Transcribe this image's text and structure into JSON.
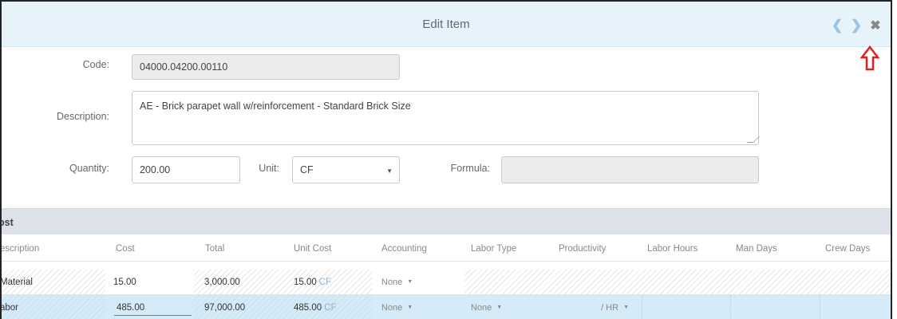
{
  "dialog": {
    "title": "Edit Item"
  },
  "header_icons": {
    "prev": "chevron-left-icon",
    "next": "chevron-right-icon",
    "close": "close-icon"
  },
  "form": {
    "code_label": "Code:",
    "code_value": "04000.04200.00110",
    "description_label": "Description:",
    "description_value": "AE - Brick parapet wall w/reinforcement - Standard Brick Size",
    "quantity_label": "Quantity:",
    "quantity_value": "200.00",
    "unit_label": "Unit:",
    "unit_value": "CF",
    "formula_label": "Formula:",
    "formula_value": ""
  },
  "cost_section": {
    "title": "ost",
    "columns": [
      "escription",
      "Cost",
      "Total",
      "Unit Cost",
      "Accounting",
      "Labor Type",
      "Productivity",
      "Labor Hours",
      "Man Days",
      "Crew Days"
    ],
    "rows": [
      {
        "description": "Material",
        "cost": "15.00",
        "total": "3,000.00",
        "unit_cost": "15.00",
        "unit": "CF",
        "accounting": "None",
        "labor_type": "",
        "productivity": "",
        "labor_hours": "",
        "man_days": "",
        "crew_days": ""
      },
      {
        "description": "abor",
        "cost": "485.00",
        "total": "97,000.00",
        "unit_cost": "485.00",
        "unit": "CF",
        "accounting": "None",
        "labor_type": "None",
        "productivity": "/ HR",
        "labor_hours": "",
        "man_days": "",
        "crew_days": ""
      }
    ]
  },
  "colors": {
    "header_bg": "#e6f3fa",
    "section_bg": "#dde1ea",
    "selected_row": "#d6ebf8",
    "accent": "#9cc3df",
    "arrow": "#e02020"
  }
}
